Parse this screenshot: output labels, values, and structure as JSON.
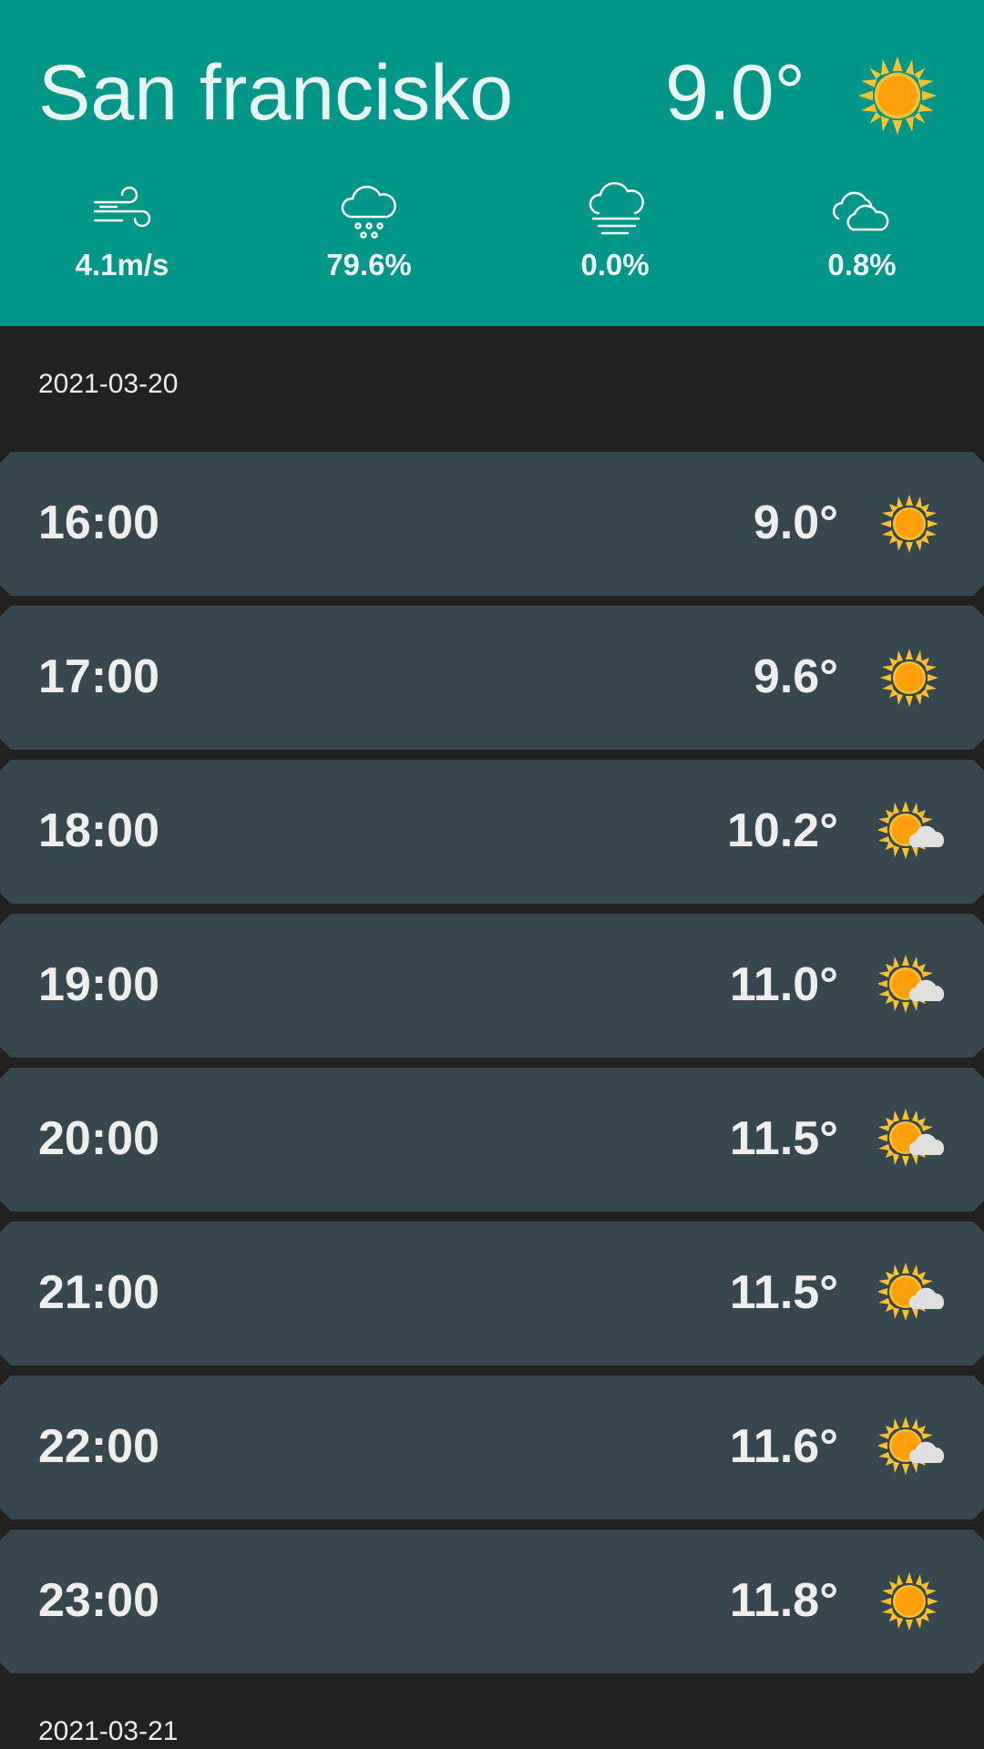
{
  "header": {
    "city": "San francisko",
    "temperature": "9.0°",
    "icon": "sun-icon",
    "stats": [
      {
        "icon": "wind-icon",
        "value": "4.1m/s"
      },
      {
        "icon": "rain-cloud-icon",
        "value": "79.6%"
      },
      {
        "icon": "fog-cloud-icon",
        "value": "0.0%"
      },
      {
        "icon": "cloud-icon",
        "value": "0.8%"
      }
    ]
  },
  "days": [
    {
      "date": "2021-03-20",
      "hours": [
        {
          "time": "16:00",
          "temp": "9.0°",
          "icon": "sun-icon"
        },
        {
          "time": "17:00",
          "temp": "9.6°",
          "icon": "sun-icon"
        },
        {
          "time": "18:00",
          "temp": "10.2°",
          "icon": "partly-cloudy-icon"
        },
        {
          "time": "19:00",
          "temp": "11.0°",
          "icon": "partly-cloudy-icon"
        },
        {
          "time": "20:00",
          "temp": "11.5°",
          "icon": "partly-cloudy-icon"
        },
        {
          "time": "21:00",
          "temp": "11.5°",
          "icon": "partly-cloudy-icon"
        },
        {
          "time": "22:00",
          "temp": "11.6°",
          "icon": "partly-cloudy-icon"
        },
        {
          "time": "23:00",
          "temp": "11.8°",
          "icon": "sun-icon"
        }
      ]
    },
    {
      "date": "2021-03-21",
      "hours": []
    }
  ],
  "colors": {
    "header_bg": "#009688",
    "page_bg": "#212121",
    "row_bg": "#37474f",
    "sun": "#fbc02d",
    "sun_core": "#ff9800"
  }
}
